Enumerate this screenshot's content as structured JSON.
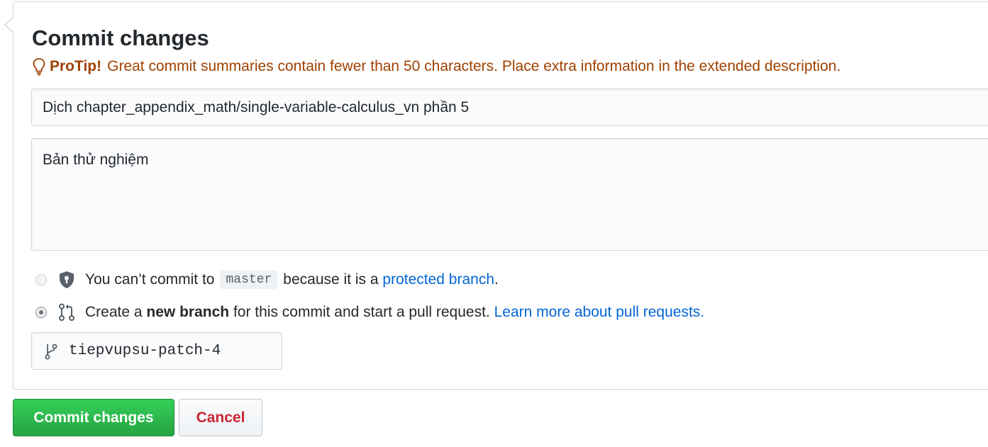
{
  "form": {
    "title": "Commit changes",
    "protip_label": "ProTip!",
    "protip_text": "Great commit summaries contain fewer than 50 characters. Place extra information in the extended description.",
    "summary_value": "Dịch chapter_appendix_math/single-variable-calculus_vn phần 5",
    "description_value": "Bản thử nghiệm"
  },
  "options": {
    "direct": {
      "text_before": "You can’t commit to",
      "branch_code": "master",
      "text_middle": "because it is a",
      "link_text": "protected branch",
      "text_after": ".",
      "icon": "shield-lock-icon",
      "selected": false
    },
    "new_branch": {
      "text_before": "Create a",
      "text_bold": "new branch",
      "text_after": "for this commit and start a pull request.",
      "link_text": "Learn more about pull requests.",
      "icon": "git-pull-request-icon",
      "selected": true
    }
  },
  "branch": {
    "name": "tiepvupsu-patch-4",
    "icon": "git-branch-icon"
  },
  "actions": {
    "commit_label": "Commit changes",
    "cancel_label": "Cancel"
  },
  "colors": {
    "protip": "#a04100",
    "link": "#0366d6",
    "commit_button": "#28a745",
    "cancel_text": "#cb2431"
  }
}
